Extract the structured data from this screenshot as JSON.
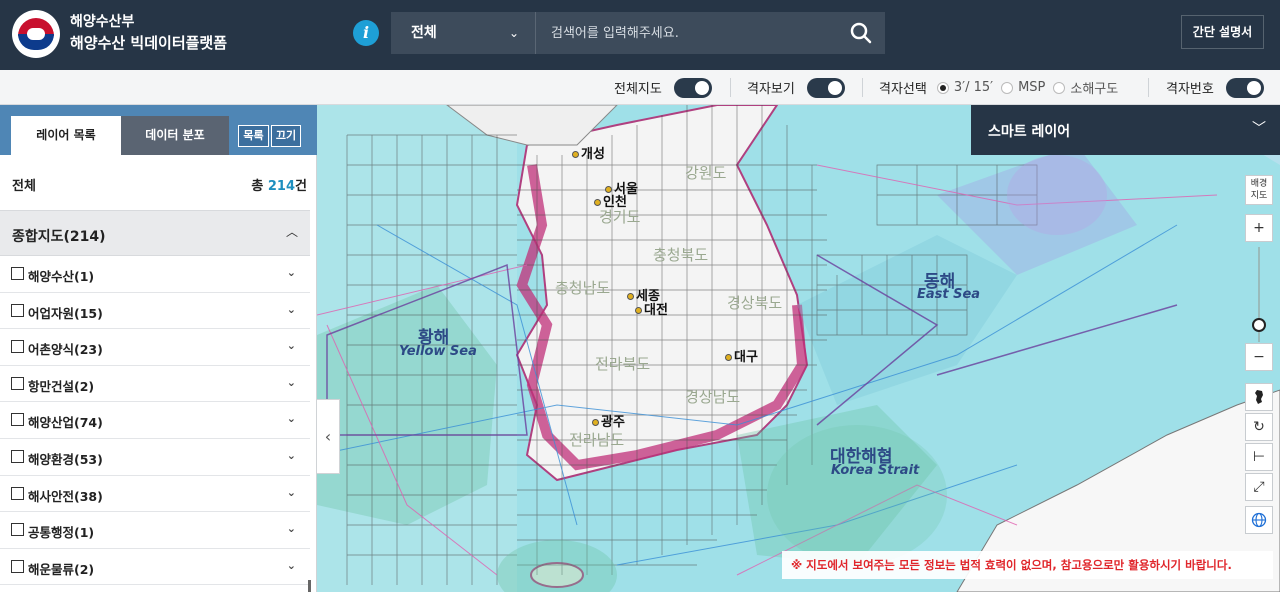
{
  "header": {
    "org_name": "해양수산부",
    "platform_name": "해양수산 빅데이터플랫폼",
    "info_icon": "info-icon",
    "search": {
      "category": "전체",
      "placeholder": "검색어를 입력해주세요.",
      "search_icon": "search-icon"
    },
    "guide_button": "간단 설명서"
  },
  "toolbar": {
    "full_map_label": "전체지도",
    "full_map_on": true,
    "grid_view_label": "격자보기",
    "grid_view_on": true,
    "grid_select_label": "격자선택",
    "grid_options": [
      "3′/ 15′",
      "MSP",
      "소해구도"
    ],
    "grid_selected": "3′/ 15′",
    "grid_number_label": "격자번호",
    "grid_number_on": true
  },
  "left_panel": {
    "tabs": [
      "레이어 목록",
      "데이터 분포"
    ],
    "active_tab": "레이어 목록",
    "list_button": "목록",
    "off_button": "끄기",
    "total_label": "전체",
    "total_prefix": "총",
    "total_count": "214",
    "total_suffix": "건",
    "group": {
      "label": "종합지도(214)",
      "expanded": true
    },
    "categories": [
      "해양수산(1)",
      "어업자원(15)",
      "어촌양식(23)",
      "항만건설(2)",
      "해양산업(74)",
      "해양환경(53)",
      "해사안전(38)",
      "공통행정(1)",
      "해운물류(2)"
    ]
  },
  "map": {
    "cities": [
      {
        "name": "개성"
      },
      {
        "name": "서울"
      },
      {
        "name": "인천"
      },
      {
        "name": "세종"
      },
      {
        "name": "대전"
      },
      {
        "name": "대구"
      },
      {
        "name": "광주"
      }
    ],
    "provinces": [
      "강원도",
      "경기도",
      "충청북도",
      "충청남도",
      "경상북도",
      "전라북도",
      "경상남도",
      "전라남도"
    ],
    "seas": [
      {
        "ko": "황해",
        "en": "Yellow Sea"
      },
      {
        "ko": "동해",
        "en": "East Sea"
      },
      {
        "ko": "대한해협",
        "en": "Korea Strait"
      }
    ],
    "smart_layer_label": "스마트 레이어",
    "base_map_label": "배경 지도",
    "disclaimer": "※ 지도에서 보여주는 모든 정보는 법적 효력이 없으며, 참고용으로만 활용하시기 바랍니다.",
    "colors": {
      "sea": "#9fe0e8",
      "land": "#f2f2f2",
      "grid": "#555555",
      "overlay": "#d8328a"
    }
  }
}
